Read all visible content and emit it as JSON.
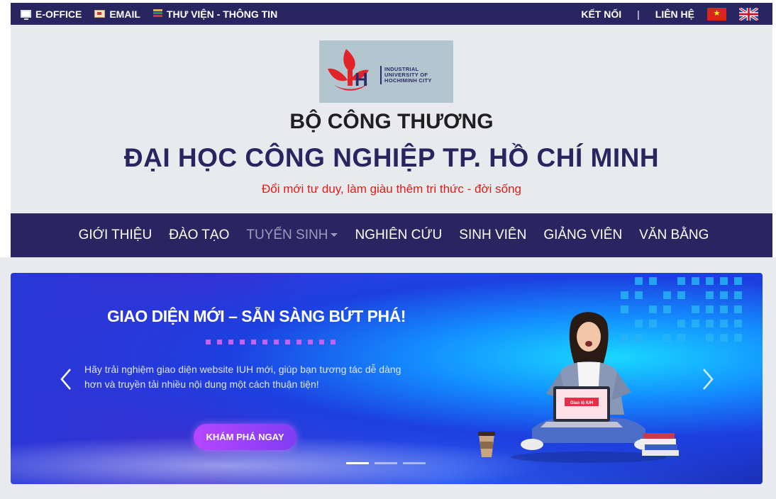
{
  "topbar": {
    "links": [
      {
        "label": "E-OFFICE",
        "icon": "monitor-icon"
      },
      {
        "label": "EMAIL",
        "icon": "mail-icon"
      },
      {
        "label": "THƯ VIỆN - THÔNG TIN",
        "icon": "books-icon"
      }
    ],
    "connect_label": "KẾT NỐI",
    "separator": "|",
    "contact_label": "LIÊN HỆ",
    "languages": [
      "vi-flag-icon",
      "uk-flag-icon"
    ]
  },
  "header": {
    "logo_text": [
      "INDUSTRIAL",
      "UNIVERSITY OF",
      "HOCHIMINH CITY"
    ],
    "logo_mark": "IUH",
    "ministry": "BỘ CÔNG THƯƠNG",
    "university": "ĐẠI HỌC CÔNG NGHIỆP TP. HỒ CHÍ MINH",
    "slogan": "Đổi mới tư duy, làm giàu thêm tri thức - đời sống"
  },
  "nav": {
    "items": [
      {
        "label": "GIỚI THIỆU"
      },
      {
        "label": "ĐÀO TẠO"
      },
      {
        "label": "TUYỂN SINH",
        "dropdown": true,
        "muted": true
      },
      {
        "label": "NGHIÊN CỨU"
      },
      {
        "label": "SINH VIÊN"
      },
      {
        "label": "GIẢNG VIÊN"
      },
      {
        "label": "VĂN BẰNG"
      }
    ]
  },
  "carousel": {
    "title": "GIAO DIỆN MỚI – SẴN SÀNG BỨT PHÁ!",
    "description": "Hãy trải nghiệm giao diện website IUH mới, giúp bạn tương tác dễ dàng hơn và truyền tải nhiều nội dung một cách thuận tiện!",
    "cta_label": "KHÁM PHÁ NGAY",
    "slide_count": 3,
    "active_slide": 1,
    "laptop_text": "Giao lộ IUH"
  },
  "colors": {
    "navy": "#282560",
    "slogan_red": "#e41b17",
    "header_bg": "#e8eaee",
    "cta_purple": "#b646ff"
  }
}
